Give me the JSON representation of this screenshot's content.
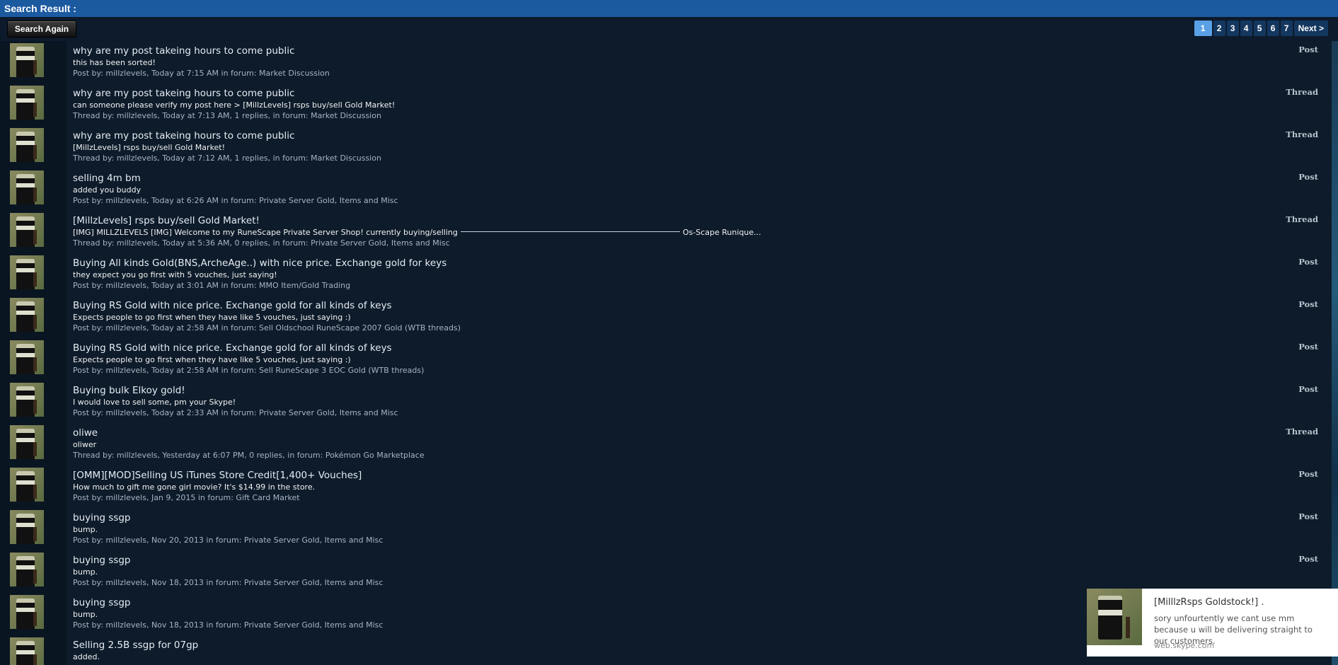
{
  "header": {
    "title": "Search Result :"
  },
  "toolbar": {
    "search_again_label": "Search Again"
  },
  "pagination": {
    "pages": [
      "1",
      "2",
      "3",
      "4",
      "5",
      "6",
      "7"
    ],
    "active_page": "1",
    "next_label": "Next >"
  },
  "results": [
    {
      "title": "why are my post takeing hours to come public",
      "snippet": "this has been sorted!",
      "meta": "Post by: millzlevels, Today at 7:15 AM in forum: Market Discussion",
      "type": "Post"
    },
    {
      "title": "why are my post takeing hours to come public",
      "snippet": "can someone please verify my post here > [MillzLevels] rsps buy/sell Gold Market!",
      "meta": "Thread by: millzlevels, Today at 7:13 AM, 1 replies, in forum: Market Discussion",
      "type": "Thread"
    },
    {
      "title": "why are my post takeing hours to come public",
      "snippet": "[MillzLevels] rsps buy/sell Gold Market!",
      "meta": "Thread by: millzlevels, Today at 7:12 AM, 1 replies, in forum: Market Discussion",
      "type": "Thread"
    },
    {
      "title": "selling 4m bm",
      "snippet": "added you buddy",
      "meta": "Post by: millzlevels, Today at 6:26 AM in forum: Private Server Gold, Items and Misc",
      "type": "Post"
    },
    {
      "title": "[MillzLevels] rsps buy/sell Gold Market!",
      "snippet": "[IMG] MILLZLEVELS [IMG] Welcome to my RuneScape Private Server Shop! currently buying/selling",
      "snippet_tail": "Os-Scape Runique...",
      "meta": "Thread by: millzlevels, Today at 5:36 AM, 0 replies, in forum: Private Server Gold, Items and Misc",
      "type": "Thread"
    },
    {
      "title": "Buying All kinds Gold(BNS,ArcheAge..) with nice price. Exchange gold for keys",
      "snippet": "they expect you go first with 5 vouches, just saying!",
      "meta": "Post by: millzlevels, Today at 3:01 AM in forum: MMO Item/Gold Trading",
      "type": "Post"
    },
    {
      "title": "Buying RS Gold with nice price. Exchange gold for all kinds of keys",
      "snippet": "Expects people to go first when they have like 5 vouches, just saying :)",
      "meta": "Post by: millzlevels, Today at 2:58 AM in forum: Sell Oldschool RuneScape 2007 Gold (WTB threads)",
      "type": "Post"
    },
    {
      "title": "Buying RS Gold with nice price. Exchange gold for all kinds of keys",
      "snippet": "Expects people to go first when they have like 5 vouches, just saying :)",
      "meta": "Post by: millzlevels, Today at 2:58 AM in forum: Sell RuneScape 3 EOC Gold (WTB threads)",
      "type": "Post"
    },
    {
      "title": "Buying bulk Elkoy gold!",
      "snippet": "I would love to sell some, pm your Skype!",
      "meta": "Post by: millzlevels, Today at 2:33 AM in forum: Private Server Gold, Items and Misc",
      "type": "Post"
    },
    {
      "title": "oliwe",
      "snippet": "oliwer",
      "meta": "Thread by: millzlevels, Yesterday at 6:07 PM, 0 replies, in forum: Pokémon Go Marketplace",
      "type": "Thread"
    },
    {
      "title": "[OMM][MOD]Selling US iTunes Store Credit[1,400+ Vouches]",
      "snippet": "How much to gift me gone girl movie? It's $14.99 in the store.",
      "meta": "Post by: millzlevels, Jan 9, 2015 in forum: Gift Card Market",
      "type": "Post"
    },
    {
      "title": "buying ssgp",
      "snippet": "bump.",
      "meta": "Post by: millzlevels, Nov 20, 2013 in forum: Private Server Gold, Items and Misc",
      "type": "Post"
    },
    {
      "title": "buying ssgp",
      "snippet": "bump.",
      "meta": "Post by: millzlevels, Nov 18, 2013 in forum: Private Server Gold, Items and Misc",
      "type": "Post"
    },
    {
      "title": "buying ssgp",
      "snippet": "bump.",
      "meta": "Post by: millzlevels, Nov 18, 2013 in forum: Private Server Gold, Items and Misc",
      "type": ""
    },
    {
      "title": "Selling 2.5B ssgp for 07gp",
      "snippet": "added.",
      "meta": "",
      "type": ""
    }
  ],
  "notification": {
    "title": "[MilllzRsps Goldstock!] .",
    "body": "sory unfourtently we cant use mm because u will be delivering straight to our customers.",
    "source": "web.skype.com"
  }
}
